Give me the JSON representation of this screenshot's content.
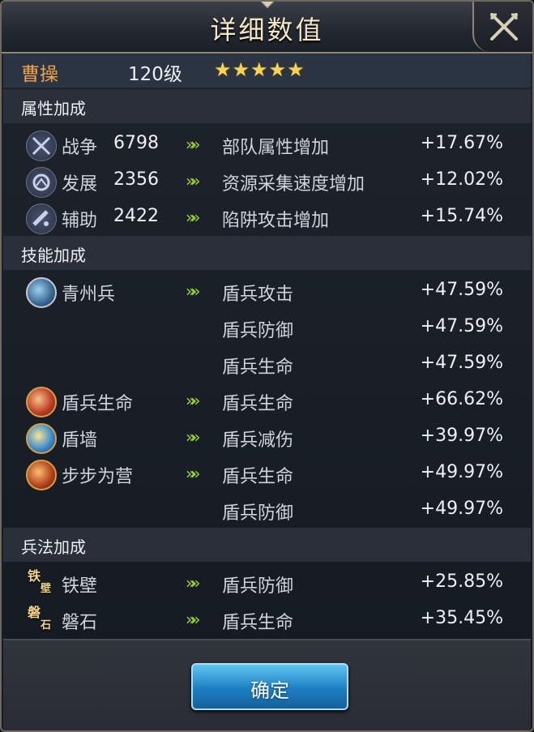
{
  "window": {
    "title": "详细数值"
  },
  "hero": {
    "name": "曹操",
    "level": "120级",
    "stars": "★★★★★"
  },
  "sections": {
    "attributes": "属性加成",
    "skills": "技能加成",
    "tactics": "兵法加成"
  },
  "arrow": "»»",
  "attribute_rows": [
    {
      "icon": "crossed-swords-icon",
      "name": "战争",
      "value": "6798",
      "desc": "部队属性增加",
      "bonus": "+17.67%"
    },
    {
      "icon": "development-icon",
      "name": "发展",
      "value": "2356",
      "desc": "资源采集速度增加",
      "bonus": "+12.02%"
    },
    {
      "icon": "assist-icon",
      "name": "辅助",
      "value": "2422",
      "desc": "陷阱攻击增加",
      "bonus": "+15.74%"
    }
  ],
  "skill_rows": [
    {
      "name": "青州兵",
      "desc": "盾兵攻击",
      "bonus": "+47.59%"
    },
    {
      "name": "",
      "desc": "盾兵防御",
      "bonus": "+47.59%"
    },
    {
      "name": "",
      "desc": "盾兵生命",
      "bonus": "+47.59%"
    },
    {
      "name": "盾兵生命",
      "desc": "盾兵生命",
      "bonus": "+66.62%"
    },
    {
      "name": "盾墙",
      "desc": "盾兵减伤",
      "bonus": "+39.97%"
    },
    {
      "name": "步步为营",
      "desc": "盾兵生命",
      "bonus": "+49.97%"
    },
    {
      "name": "",
      "desc": "盾兵防御",
      "bonus": "+49.97%"
    }
  ],
  "tactic_rows": [
    {
      "icon_a": "铁",
      "icon_b": "壁",
      "name": "铁壁",
      "desc": "盾兵防御",
      "bonus": "+25.85%"
    },
    {
      "icon_a": "磐",
      "icon_b": "石",
      "name": "磐石",
      "desc": "盾兵生命",
      "bonus": "+35.45%"
    }
  ],
  "buttons": {
    "confirm": "确定"
  }
}
